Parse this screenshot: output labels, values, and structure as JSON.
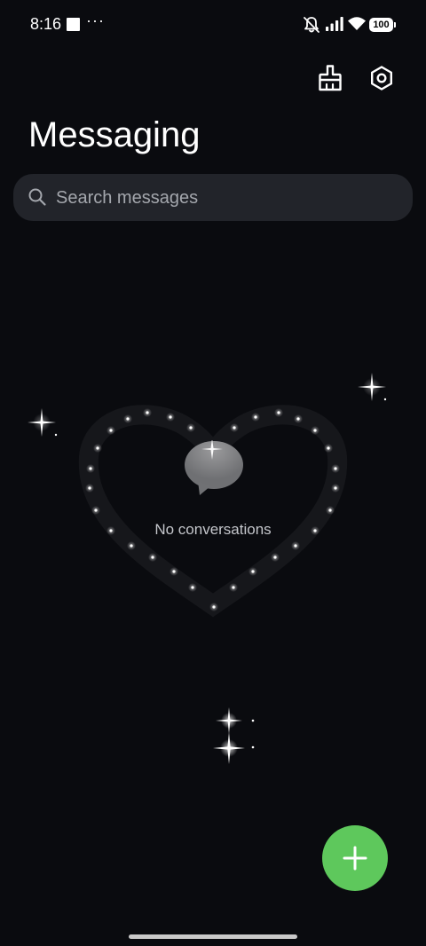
{
  "status_bar": {
    "time": "8:16",
    "more_indicator": "···",
    "battery_level": "100",
    "icons": [
      "square-icon",
      "mute-bell-icon",
      "signal-icon",
      "wifi-icon",
      "battery-icon"
    ]
  },
  "header": {
    "title": "Messaging",
    "actions": [
      {
        "name": "broom-icon",
        "action": "clean"
      },
      {
        "name": "settings-gear-icon",
        "action": "settings"
      }
    ]
  },
  "search": {
    "placeholder": "Search messages",
    "value": "",
    "icon": "search-icon"
  },
  "empty_state": {
    "icon": "chat-bubble-icon",
    "message": "No conversations",
    "decoration": "sparkle-heart"
  },
  "fab": {
    "icon": "plus-icon",
    "color": "#5ec85c"
  },
  "colors": {
    "background": "#0a0b0f",
    "search_background": "#22242a",
    "accent": "#5ec85c",
    "text_primary": "#ffffff",
    "text_secondary": "#c4c6cb"
  }
}
